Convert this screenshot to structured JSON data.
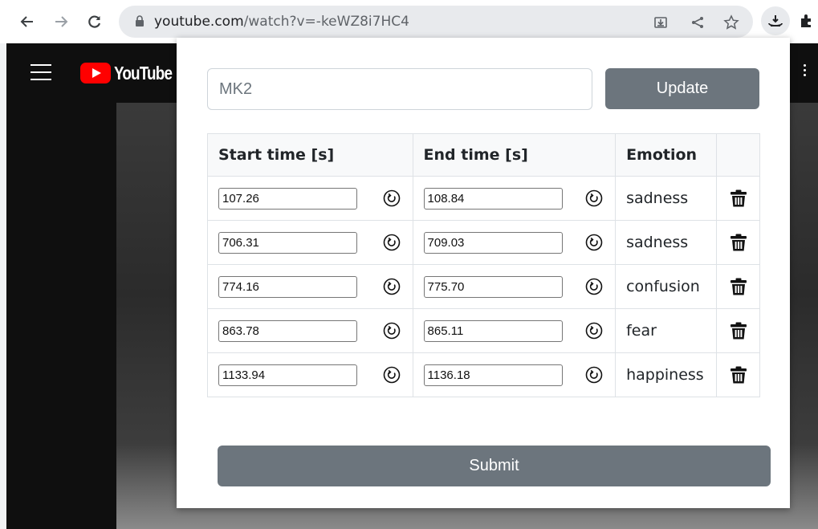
{
  "browser": {
    "url_host": "youtube.com",
    "url_path": "/watch?v=-keWZ8i7HC4"
  },
  "youtube": {
    "logo_text": "YouTube"
  },
  "popup": {
    "name_placeholder": "MK2",
    "update_label": "Update",
    "submit_label": "Submit",
    "table": {
      "headers": {
        "start": "Start time [s]",
        "end": "End time [s]",
        "emotion": "Emotion"
      },
      "rows": [
        {
          "start": "107.26",
          "end": "108.84",
          "emotion": "sadness"
        },
        {
          "start": "706.31",
          "end": "709.03",
          "emotion": "sadness"
        },
        {
          "start": "774.16",
          "end": "775.70",
          "emotion": "confusion"
        },
        {
          "start": "863.78",
          "end": "865.11",
          "emotion": "fear"
        },
        {
          "start": "1133.94",
          "end": "1136.18",
          "emotion": "happiness"
        }
      ]
    }
  },
  "colors": {
    "button_gray": "#6c757d",
    "youtube_red": "#ff0000"
  },
  "icons": {
    "reset": "reset-icon",
    "delete": "trash-icon"
  }
}
